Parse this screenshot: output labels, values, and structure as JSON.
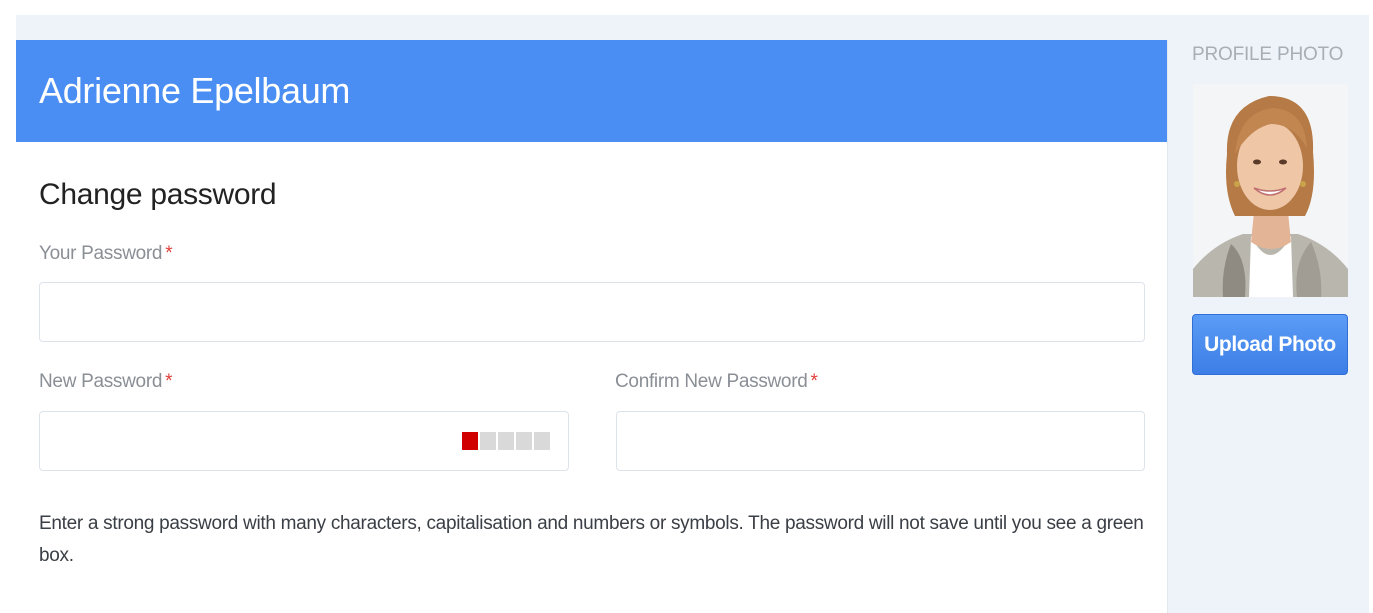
{
  "profile": {
    "name": "Adrienne Epelbaum"
  },
  "change_password": {
    "title": "Change password",
    "required_marker": "*",
    "your_password": {
      "label": "Your Password",
      "value": "",
      "placeholder": ""
    },
    "new_password": {
      "label": "New Password",
      "value": "",
      "placeholder": "",
      "strength": {
        "segments_total": 5,
        "segments_filled": 1,
        "filled_color": "#d00000",
        "empty_color": "#d9d9d9"
      }
    },
    "confirm_password": {
      "label": "Confirm New Password",
      "value": "",
      "placeholder": ""
    },
    "help_text": "Enter a strong password with many characters, capitalisation and numbers or symbols. The password will not save until you see a green box."
  },
  "sidebar": {
    "heading": "PROFILE PHOTO",
    "photo_icon": "avatar-portrait",
    "upload_label": "Upload Photo"
  },
  "colors": {
    "header_blue": "#4a8ef3",
    "required_red": "#e0403b",
    "button_blue": "#3c7ee6"
  }
}
